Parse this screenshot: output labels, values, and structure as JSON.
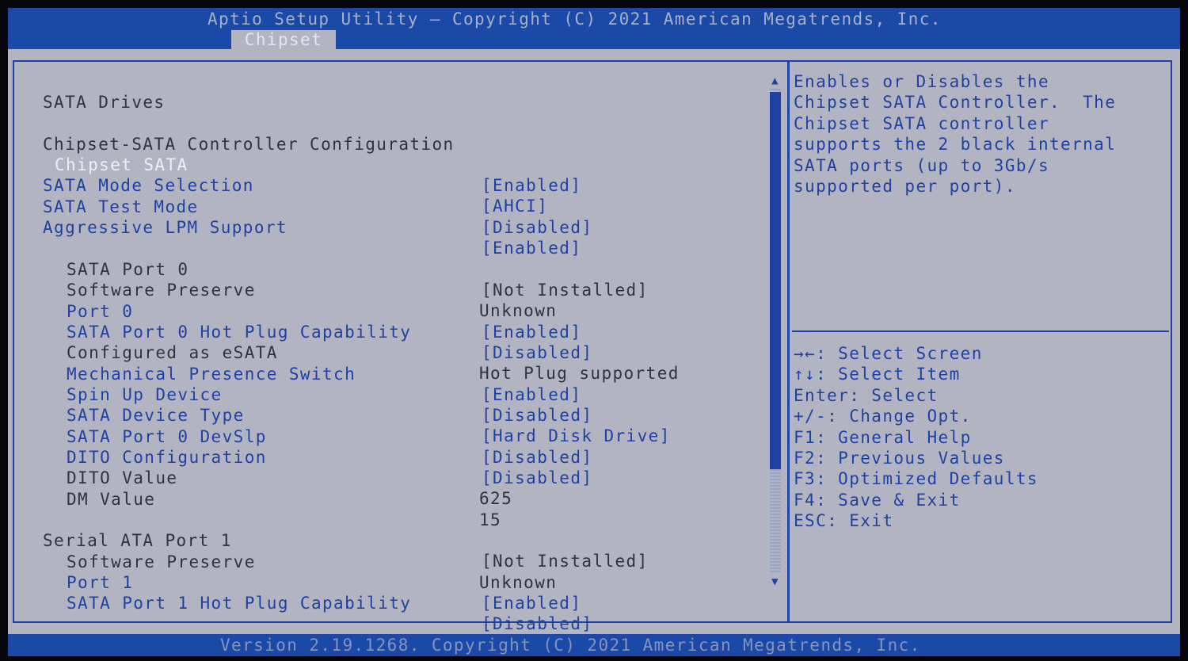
{
  "header": {
    "title": "Aptio Setup Utility – Copyright (C) 2021 American Megatrends, Inc.",
    "active_tab": "Chipset"
  },
  "settings": {
    "section_title": "SATA Drives",
    "group_title": "Chipset-SATA Controller Configuration",
    "rows": [
      {
        "label": "Chipset SATA",
        "value": "[Enabled]"
      },
      {
        "label": "SATA Mode Selection",
        "value": "[AHCI]"
      },
      {
        "label": "SATA Test Mode",
        "value": "[Disabled]"
      },
      {
        "label": "Aggressive LPM Support",
        "value": "[Enabled]"
      },
      {
        "label": "SATA Port 0",
        "value": "[Not Installed]"
      },
      {
        "label": "Software Preserve",
        "value": "Unknown"
      },
      {
        "label": "Port 0",
        "value": "[Enabled]"
      },
      {
        "label": "SATA Port 0 Hot Plug Capability",
        "value": "[Disabled]"
      },
      {
        "label": "Configured as eSATA",
        "value": "Hot Plug supported"
      },
      {
        "label": "Mechanical Presence Switch",
        "value": "[Enabled]"
      },
      {
        "label": "Spin Up Device",
        "value": "[Disabled]"
      },
      {
        "label": "SATA Device Type",
        "value": "[Hard Disk Drive]"
      },
      {
        "label": "SATA Port 0 DevSlp",
        "value": "[Disabled]"
      },
      {
        "label": "DITO Configuration",
        "value": "[Disabled]"
      },
      {
        "label": "DITO Value",
        "value": "625"
      },
      {
        "label": "DM Value",
        "value": "15"
      },
      {
        "label": "Serial ATA Port 1",
        "value": "[Not Installed]"
      },
      {
        "label": "Software Preserve",
        "value": "Unknown"
      },
      {
        "label": "Port 1",
        "value": "[Enabled]"
      },
      {
        "label": "SATA Port 1 Hot Plug Capability",
        "value": "[Disabled]"
      }
    ]
  },
  "help_text": "Enables or Disables the\nChipset SATA Controller.  The\nChipset SATA controller\nsupports the 2 black internal\nSATA ports (up to 3Gb/s\nsupported per port).",
  "key_help": [
    "→←: Select Screen",
    "↑↓: Select Item",
    "Enter: Select",
    "+/-: Change Opt.",
    "F1: General Help",
    "F2: Previous Values",
    "F3: Optimized Defaults",
    "F4: Save & Exit",
    "ESC: Exit"
  ],
  "scrollbar": {
    "position": 0
  },
  "footer": "Version 2.19.1268. Copyright (C) 2021 American Megatrends, Inc.",
  "colors": {
    "bar_blue": "#1b49a8",
    "panel_gray": "#b3b4c1",
    "accent_blue": "#1d42a3",
    "highlight_white": "#eef0f6"
  }
}
